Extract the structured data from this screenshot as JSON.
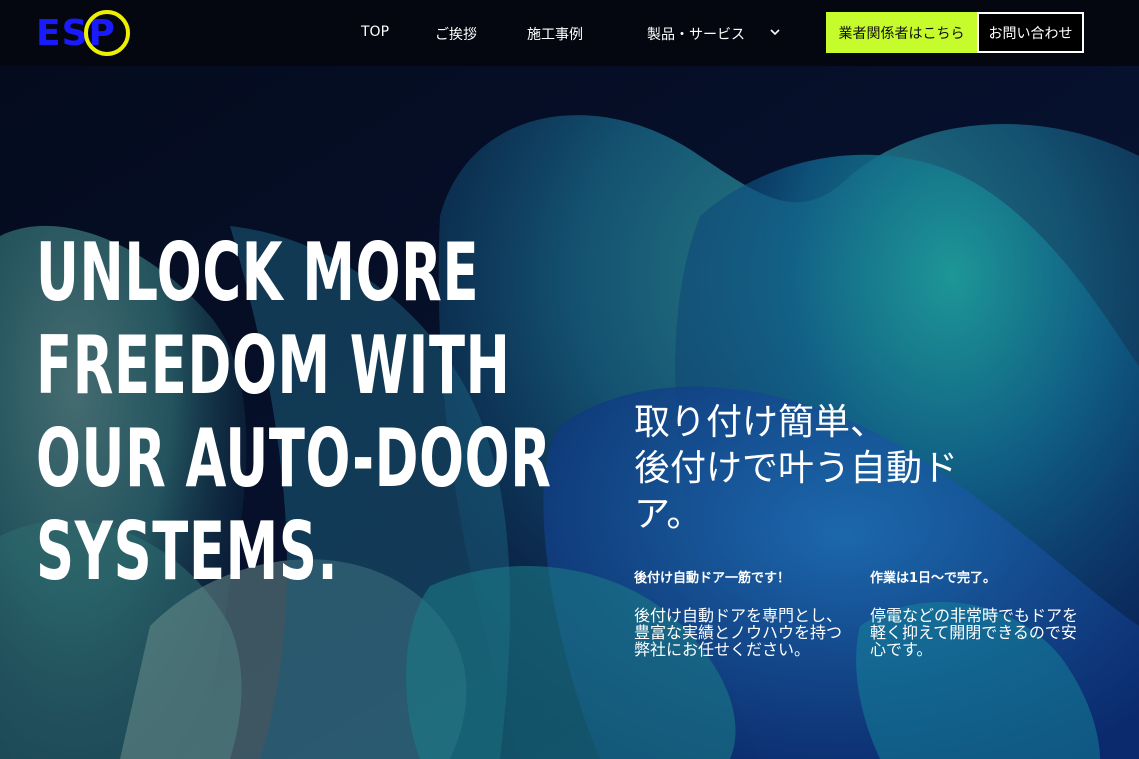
{
  "header": {
    "logo_text": "ESP",
    "nav": [
      {
        "label": "TOP"
      },
      {
        "label": "ご挨拶"
      },
      {
        "label": "施工事例"
      },
      {
        "label": "製品・サービス"
      }
    ],
    "trade_button": "業者関係者はこちら",
    "contact_button": "お問い合わせ"
  },
  "hero": {
    "headline_lines": [
      "UNLOCK MORE",
      "FREEDOM WITH",
      "OUR AUTO-DOOR",
      "SYSTEMS."
    ],
    "jp_title_lines": [
      "取り付け簡単、",
      "後付けで叶う自動ド",
      "ア。"
    ],
    "features": [
      {
        "heading": "後付け自動ドア一筋です！",
        "body": "後付け自動ドアを専門とし、豊富な実績とノウハウを持つ弊社にお任せください。"
      },
      {
        "heading": "作業は1日〜で完了。",
        "body": "停電などの非常時でもドアを軽く抑えて開閉できるので安心です。"
      }
    ]
  },
  "colors": {
    "header_bg": "#04070f",
    "logo_blue": "#1a1aff",
    "logo_ring": "#eef000",
    "trade_button_bg": "#c6fb2c",
    "hero_bg": "#050b1c"
  },
  "icons": {
    "dropdown": "chevron-down-icon"
  }
}
